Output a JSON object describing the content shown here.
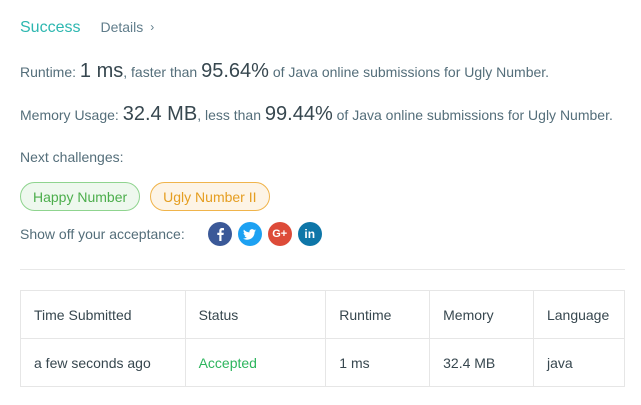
{
  "header": {
    "status": "Success",
    "details_label": "Details",
    "details_icon": "chevron-right-icon"
  },
  "runtime": {
    "prefix": "Runtime: ",
    "value": "1 ms",
    "middle": ", faster than ",
    "percent": "95.64%",
    "suffix": " of Java online submissions for Ugly Number."
  },
  "memory": {
    "prefix": "Memory Usage: ",
    "value": "32.4 MB",
    "middle": ", less than ",
    "percent": "99.44%",
    "suffix": " of Java online submissions for Ugly Number."
  },
  "next": {
    "label": "Next challenges:",
    "challenges": [
      {
        "name": "Happy Number",
        "difficulty_color": "#4cae4c"
      },
      {
        "name": "Ugly Number II",
        "difficulty_color": "#e59e21"
      }
    ]
  },
  "share": {
    "label": "Show off your acceptance:",
    "icons": [
      "facebook-icon",
      "twitter-icon",
      "google-plus-icon",
      "linkedin-icon"
    ]
  },
  "table": {
    "headers": [
      "Time Submitted",
      "Status",
      "Runtime",
      "Memory",
      "Language"
    ],
    "rows": [
      {
        "time": "a few seconds ago",
        "status": "Accepted",
        "runtime": "1 ms",
        "memory": "32.4 MB",
        "language": "java"
      }
    ]
  },
  "colors": {
    "success": "#2db7b0",
    "accepted": "#2db55d"
  }
}
